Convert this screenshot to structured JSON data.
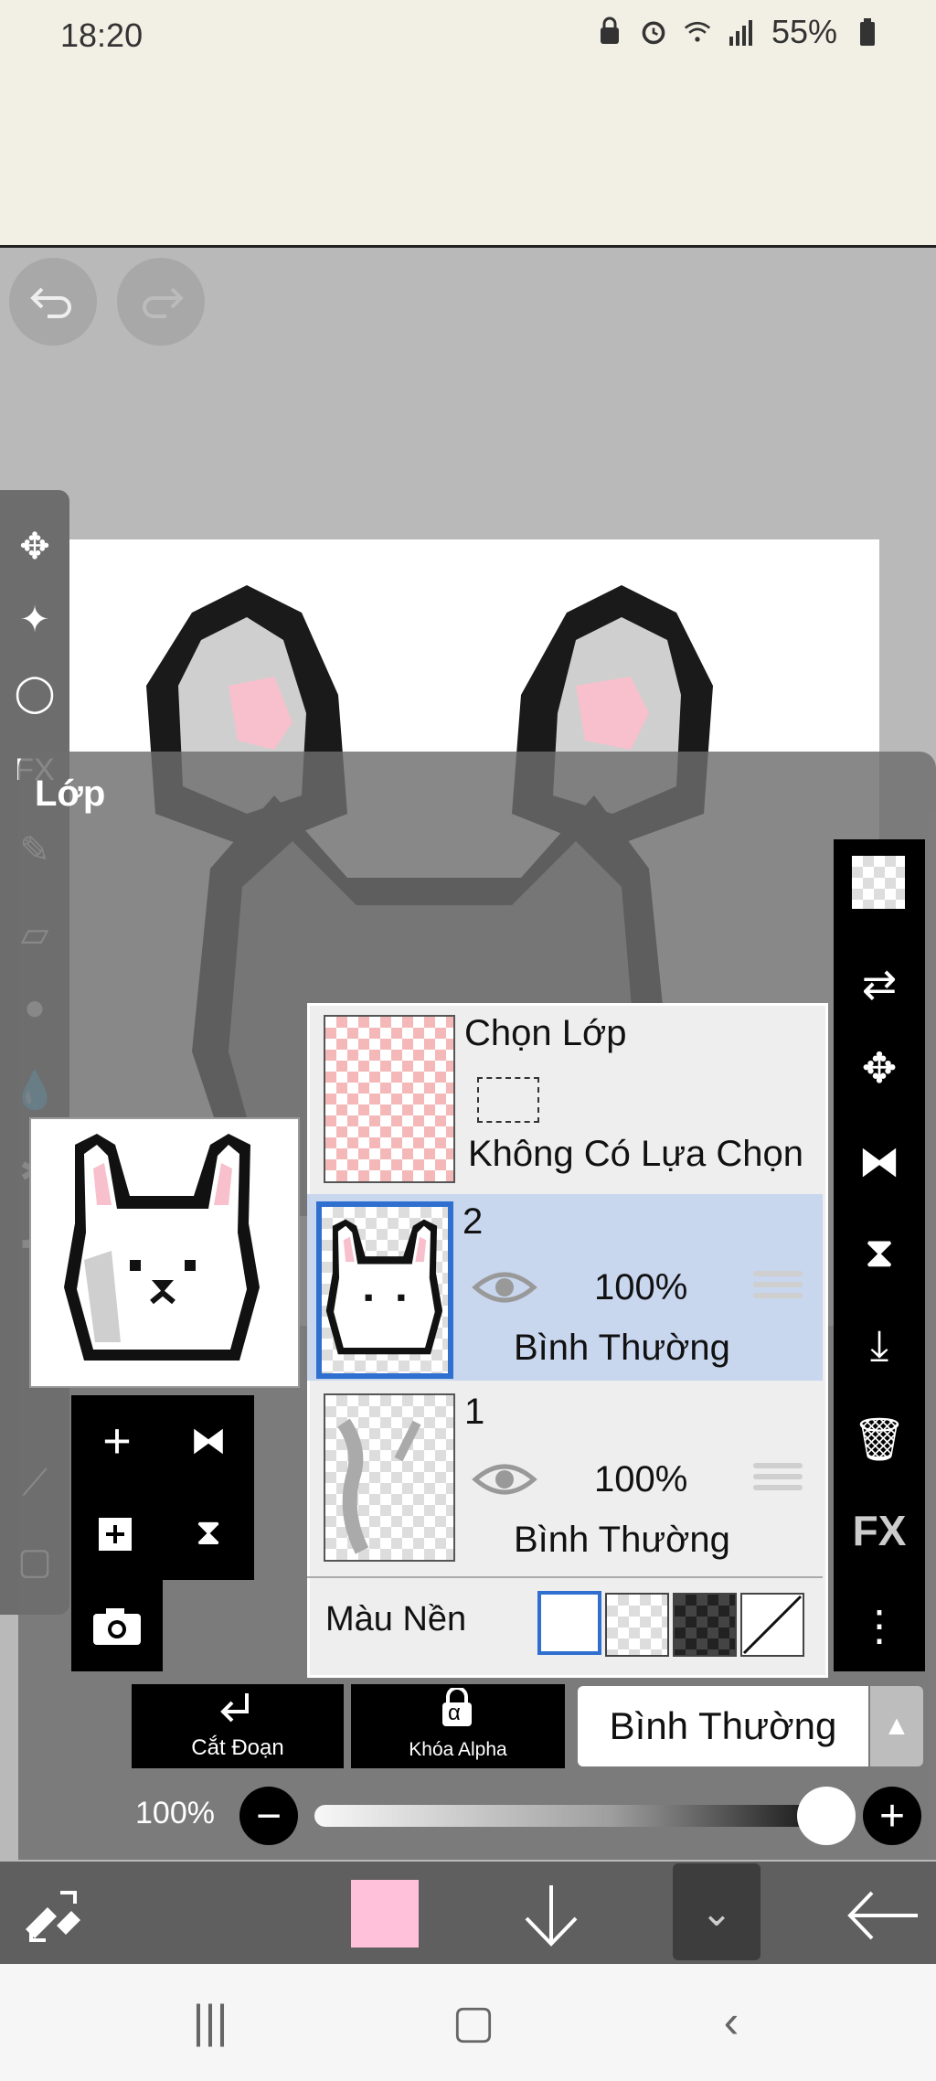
{
  "status_bar": {
    "time": "18:20",
    "battery": "55%",
    "icons": [
      "lock-icon",
      "alarm-icon",
      "wifi-icon",
      "signal-icon",
      "battery-icon"
    ]
  },
  "canvas": {
    "undo_icon": "undo-icon",
    "redo_icon": "redo-icon"
  },
  "left_tools": [
    "move-tool-icon",
    "magic-wand-icon",
    "lasso-icon",
    "fx-icon",
    "brush-icon",
    "eraser-icon",
    "smudge-icon",
    "fill-icon",
    "blur-icon",
    "pen-icon",
    "eyedropper-icon",
    "frame-icon"
  ],
  "left_tools_fx_label": "FX",
  "panel": {
    "title": "Lớp"
  },
  "layers": {
    "selection_layer": {
      "title": "Chọn Lớp",
      "status": "Không Có Lựa Chọn"
    },
    "items": [
      {
        "number": "2",
        "opacity": "100%",
        "mode": "Bình Thường",
        "selected": true
      },
      {
        "number": "1",
        "opacity": "100%",
        "mode": "Bình Thường",
        "selected": false
      }
    ],
    "background_label": "Màu Nền"
  },
  "layer_actions": {
    "add": "+",
    "icons": [
      "add-layer-icon",
      "flip-layer-icon",
      "duplicate-layer-icon",
      "merge-icon",
      "camera-icon"
    ]
  },
  "right_tools": {
    "fx_label": "FX",
    "icons": [
      "transparency-icon",
      "transform-swap-icon",
      "move-icon",
      "flip-icon",
      "flatten-icon",
      "merge-down-icon",
      "trash-icon",
      "fx-icon",
      "more-icon"
    ]
  },
  "controls": {
    "clip_label": "Cắt Đoạn",
    "alpha_lock_label": "Khóa Alpha",
    "alpha_symbol": "α",
    "blend_mode": "Bình Thường",
    "opacity_label": "100%",
    "opacity_value": 100
  },
  "colors": {
    "current_color": "#ffc0d9",
    "selection_blue": "#2f6fd0"
  }
}
